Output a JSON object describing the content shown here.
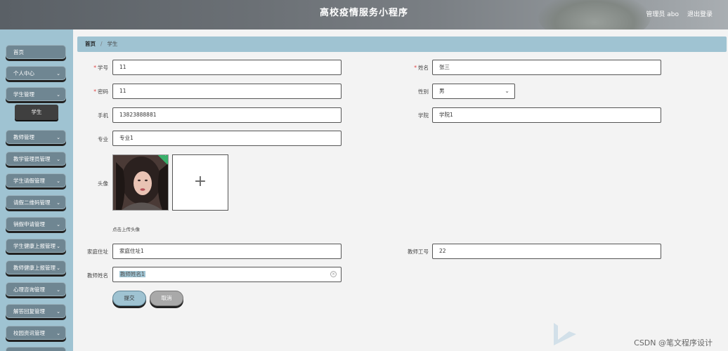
{
  "header": {
    "title": "高校疫情服务小程序",
    "admin": "管理员 abo",
    "logout": "退出登录"
  },
  "sidebar": {
    "items": [
      {
        "label": "首页",
        "has_chevron": false
      },
      {
        "label": "个人中心",
        "has_chevron": true
      },
      {
        "label": "学生管理",
        "has_chevron": true
      },
      {
        "label": "教师管理",
        "has_chevron": true
      },
      {
        "label": "教学管理员管理",
        "has_chevron": true
      },
      {
        "label": "学生请假管理",
        "has_chevron": true
      },
      {
        "label": "请假二维码管理",
        "has_chevron": true
      },
      {
        "label": "销假申请管理",
        "has_chevron": true
      },
      {
        "label": "学生健康上报管理",
        "has_chevron": true
      },
      {
        "label": "教师健康上报管理",
        "has_chevron": true
      },
      {
        "label": "心理咨询管理",
        "has_chevron": true
      },
      {
        "label": "解答回复管理",
        "has_chevron": true
      },
      {
        "label": "校园资讯管理",
        "has_chevron": true
      }
    ],
    "submenu": {
      "label": "学生"
    },
    "chevron": "⌄"
  },
  "breadcrumb": {
    "home": "首页",
    "separator": "/",
    "current": "学生"
  },
  "form": {
    "student_id": {
      "label": "学号",
      "value": "11",
      "required": true
    },
    "name": {
      "label": "姓名",
      "value": "张三",
      "required": true
    },
    "password": {
      "label": "密码",
      "value": "11",
      "required": true
    },
    "gender": {
      "label": "性别",
      "value": "男"
    },
    "phone": {
      "label": "手机",
      "value": "13823888881"
    },
    "college": {
      "label": "学院",
      "value": "学院1"
    },
    "major": {
      "label": "专业",
      "value": "专业1"
    },
    "avatar": {
      "label": "头像",
      "hint": "点击上传头像",
      "plus": "+"
    },
    "address": {
      "label": "家庭住址",
      "value": "家庭住址1"
    },
    "teacher_id": {
      "label": "教师工号",
      "value": "22"
    },
    "teacher_name": {
      "label": "教师姓名",
      "value": "教师姓名1"
    }
  },
  "buttons": {
    "submit": "提交",
    "cancel": "取消"
  },
  "watermark": "CSDN @笔文程序设计",
  "colors": {
    "accent": "#9fc3d2",
    "menu": "#6f8692",
    "active_submenu": "#3f3f3f",
    "required": "#e04040"
  }
}
